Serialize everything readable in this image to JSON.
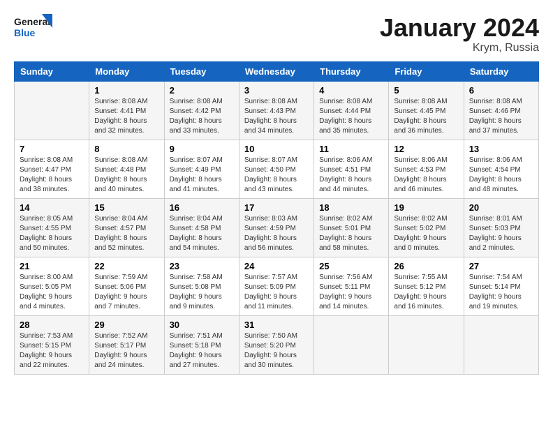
{
  "header": {
    "logo_line1": "General",
    "logo_line2": "Blue",
    "title": "January 2024",
    "subtitle": "Krym, Russia"
  },
  "weekdays": [
    "Sunday",
    "Monday",
    "Tuesday",
    "Wednesday",
    "Thursday",
    "Friday",
    "Saturday"
  ],
  "weeks": [
    [
      {
        "day": "",
        "info": ""
      },
      {
        "day": "1",
        "info": "Sunrise: 8:08 AM\nSunset: 4:41 PM\nDaylight: 8 hours\nand 32 minutes."
      },
      {
        "day": "2",
        "info": "Sunrise: 8:08 AM\nSunset: 4:42 PM\nDaylight: 8 hours\nand 33 minutes."
      },
      {
        "day": "3",
        "info": "Sunrise: 8:08 AM\nSunset: 4:43 PM\nDaylight: 8 hours\nand 34 minutes."
      },
      {
        "day": "4",
        "info": "Sunrise: 8:08 AM\nSunset: 4:44 PM\nDaylight: 8 hours\nand 35 minutes."
      },
      {
        "day": "5",
        "info": "Sunrise: 8:08 AM\nSunset: 4:45 PM\nDaylight: 8 hours\nand 36 minutes."
      },
      {
        "day": "6",
        "info": "Sunrise: 8:08 AM\nSunset: 4:46 PM\nDaylight: 8 hours\nand 37 minutes."
      }
    ],
    [
      {
        "day": "7",
        "info": "Sunrise: 8:08 AM\nSunset: 4:47 PM\nDaylight: 8 hours\nand 38 minutes."
      },
      {
        "day": "8",
        "info": "Sunrise: 8:08 AM\nSunset: 4:48 PM\nDaylight: 8 hours\nand 40 minutes."
      },
      {
        "day": "9",
        "info": "Sunrise: 8:07 AM\nSunset: 4:49 PM\nDaylight: 8 hours\nand 41 minutes."
      },
      {
        "day": "10",
        "info": "Sunrise: 8:07 AM\nSunset: 4:50 PM\nDaylight: 8 hours\nand 43 minutes."
      },
      {
        "day": "11",
        "info": "Sunrise: 8:06 AM\nSunset: 4:51 PM\nDaylight: 8 hours\nand 44 minutes."
      },
      {
        "day": "12",
        "info": "Sunrise: 8:06 AM\nSunset: 4:53 PM\nDaylight: 8 hours\nand 46 minutes."
      },
      {
        "day": "13",
        "info": "Sunrise: 8:06 AM\nSunset: 4:54 PM\nDaylight: 8 hours\nand 48 minutes."
      }
    ],
    [
      {
        "day": "14",
        "info": "Sunrise: 8:05 AM\nSunset: 4:55 PM\nDaylight: 8 hours\nand 50 minutes."
      },
      {
        "day": "15",
        "info": "Sunrise: 8:04 AM\nSunset: 4:57 PM\nDaylight: 8 hours\nand 52 minutes."
      },
      {
        "day": "16",
        "info": "Sunrise: 8:04 AM\nSunset: 4:58 PM\nDaylight: 8 hours\nand 54 minutes."
      },
      {
        "day": "17",
        "info": "Sunrise: 8:03 AM\nSunset: 4:59 PM\nDaylight: 8 hours\nand 56 minutes."
      },
      {
        "day": "18",
        "info": "Sunrise: 8:02 AM\nSunset: 5:01 PM\nDaylight: 8 hours\nand 58 minutes."
      },
      {
        "day": "19",
        "info": "Sunrise: 8:02 AM\nSunset: 5:02 PM\nDaylight: 9 hours\nand 0 minutes."
      },
      {
        "day": "20",
        "info": "Sunrise: 8:01 AM\nSunset: 5:03 PM\nDaylight: 9 hours\nand 2 minutes."
      }
    ],
    [
      {
        "day": "21",
        "info": "Sunrise: 8:00 AM\nSunset: 5:05 PM\nDaylight: 9 hours\nand 4 minutes."
      },
      {
        "day": "22",
        "info": "Sunrise: 7:59 AM\nSunset: 5:06 PM\nDaylight: 9 hours\nand 7 minutes."
      },
      {
        "day": "23",
        "info": "Sunrise: 7:58 AM\nSunset: 5:08 PM\nDaylight: 9 hours\nand 9 minutes."
      },
      {
        "day": "24",
        "info": "Sunrise: 7:57 AM\nSunset: 5:09 PM\nDaylight: 9 hours\nand 11 minutes."
      },
      {
        "day": "25",
        "info": "Sunrise: 7:56 AM\nSunset: 5:11 PM\nDaylight: 9 hours\nand 14 minutes."
      },
      {
        "day": "26",
        "info": "Sunrise: 7:55 AM\nSunset: 5:12 PM\nDaylight: 9 hours\nand 16 minutes."
      },
      {
        "day": "27",
        "info": "Sunrise: 7:54 AM\nSunset: 5:14 PM\nDaylight: 9 hours\nand 19 minutes."
      }
    ],
    [
      {
        "day": "28",
        "info": "Sunrise: 7:53 AM\nSunset: 5:15 PM\nDaylight: 9 hours\nand 22 minutes."
      },
      {
        "day": "29",
        "info": "Sunrise: 7:52 AM\nSunset: 5:17 PM\nDaylight: 9 hours\nand 24 minutes."
      },
      {
        "day": "30",
        "info": "Sunrise: 7:51 AM\nSunset: 5:18 PM\nDaylight: 9 hours\nand 27 minutes."
      },
      {
        "day": "31",
        "info": "Sunrise: 7:50 AM\nSunset: 5:20 PM\nDaylight: 9 hours\nand 30 minutes."
      },
      {
        "day": "",
        "info": ""
      },
      {
        "day": "",
        "info": ""
      },
      {
        "day": "",
        "info": ""
      }
    ]
  ]
}
